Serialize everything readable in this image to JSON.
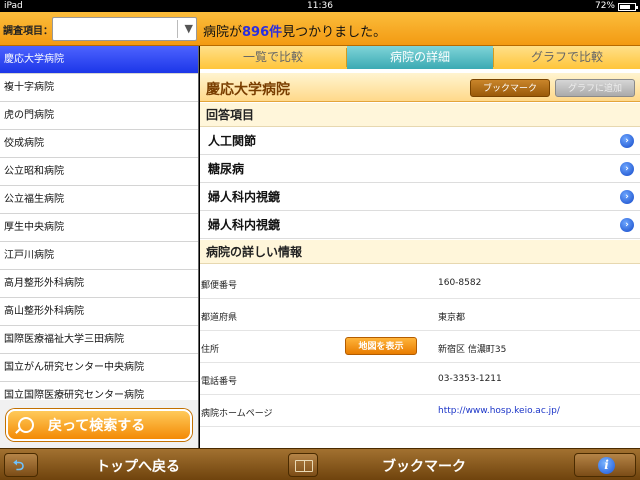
{
  "status": {
    "device": "iPad",
    "time": "11:36",
    "battery": "72%",
    "battery_level": 0.72
  },
  "topbar": {
    "survey_label": "調査項目：",
    "survey_value": "",
    "result_prefix": "病院が",
    "result_count": "896件",
    "result_suffix": "見つかりました。"
  },
  "sidebar": {
    "items": [
      {
        "label": "慶応大学病院",
        "selected": true
      },
      {
        "label": "複十字病院"
      },
      {
        "label": "虎の門病院"
      },
      {
        "label": "佼成病院"
      },
      {
        "label": "公立昭和病院"
      },
      {
        "label": "公立福生病院"
      },
      {
        "label": "厚生中央病院"
      },
      {
        "label": "江戸川病院"
      },
      {
        "label": "高月整形外科病院"
      },
      {
        "label": "高山整形外科病院"
      },
      {
        "label": "国際医療福祉大学三田病院"
      },
      {
        "label": "国立がん研究センター中央病院"
      },
      {
        "label": "国立国際医療研究センター病院"
      }
    ],
    "back_search_label": "戻って検索する"
  },
  "tabs": [
    {
      "label": "一覧で比較"
    },
    {
      "label": "病院の詳細",
      "active": true
    },
    {
      "label": "グラフで比較"
    }
  ],
  "detail": {
    "hospital_name": "慶応大学病院",
    "bookmark_label": "ブックマーク",
    "add_graph_label": "グラフに追加",
    "answers_heading": "回答項目",
    "answers": [
      "人工関節",
      "糖尿病",
      "婦人科内視鏡",
      "婦人科内視鏡"
    ],
    "info_heading": "病院の詳しい情報",
    "info": [
      {
        "key": "郵便番号",
        "value": "160-8582"
      },
      {
        "key": "都道府県",
        "value": "東京都"
      },
      {
        "key": "住所",
        "value": "新宿区 信濃町35",
        "button": "地図を表示"
      },
      {
        "key": "電話番号",
        "value": "03-3353-1211"
      },
      {
        "key": "病院ホームページ",
        "value": "http://www.hosp.keio.ac.jp/",
        "link": true
      }
    ]
  },
  "bottombar": {
    "back_top_label": "トップへ戻る",
    "bookmark_label": "ブックマーク",
    "icons": [
      "back-arrow-icon",
      "book-icon",
      "info-icon"
    ]
  }
}
